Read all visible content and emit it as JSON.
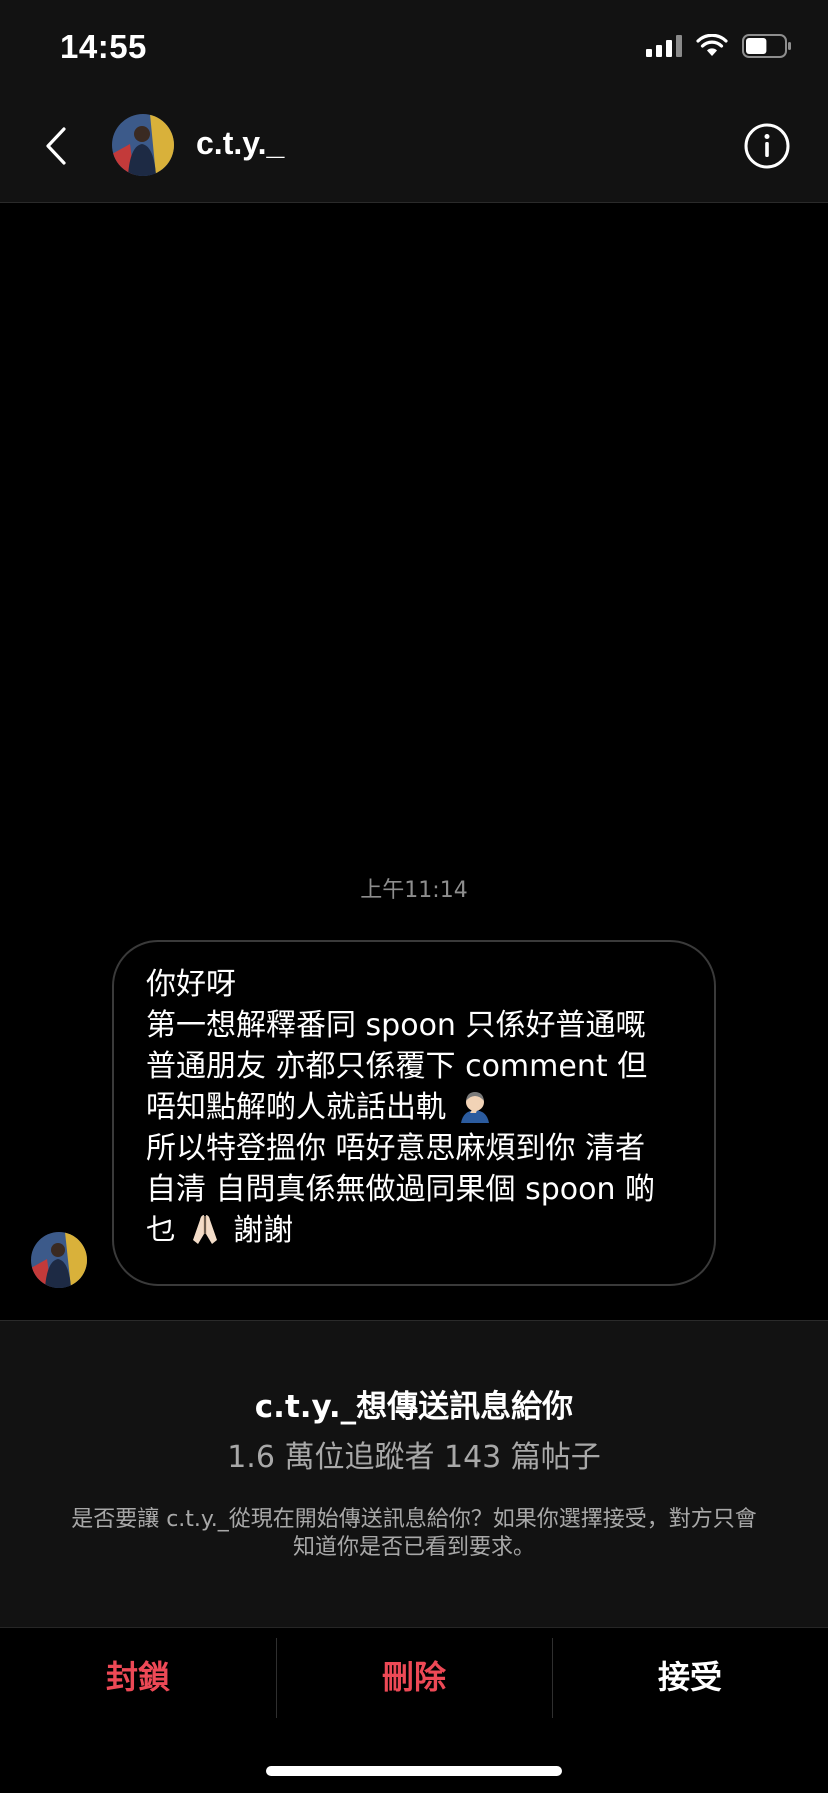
{
  "status_bar": {
    "time": "14:55",
    "icons": [
      "cellular-signal-icon",
      "wifi-icon",
      "battery-icon"
    ],
    "battery_level": 0.55
  },
  "header": {
    "username": "c.t.y._",
    "icons": [
      "back-chevron-icon",
      "avatar",
      "info-icon"
    ]
  },
  "chat": {
    "timestamp": "上午11:14",
    "message_lines": [
      "你好呀",
      "第一想解釋番同 spoon 只係好普通嘅",
      "普通朋友 亦都只係覆下 comment 但",
      "唔知點解啲人就話出軌",
      "所以特登搵你 唔好意思麻煩到你 清者",
      "自清 自問真係無做過同果個 spoon 啲",
      "乜",
      "謝謝"
    ]
  },
  "request": {
    "title": "c.t.y._想傳送訊息給你",
    "stats": "1.6 萬位追蹤者 143 篇帖子",
    "description": "是否要讓 c.t.y._從現在開始傳送訊息給你？如果你選擇接受，對方只會知道你是否已看到要求。"
  },
  "actions": {
    "block": "封鎖",
    "delete": "刪除",
    "accept": "接受"
  },
  "colors": {
    "background": "#000000",
    "panel": "#121212",
    "danger": "#ed4956",
    "secondary_text": "#a8a8a8"
  }
}
